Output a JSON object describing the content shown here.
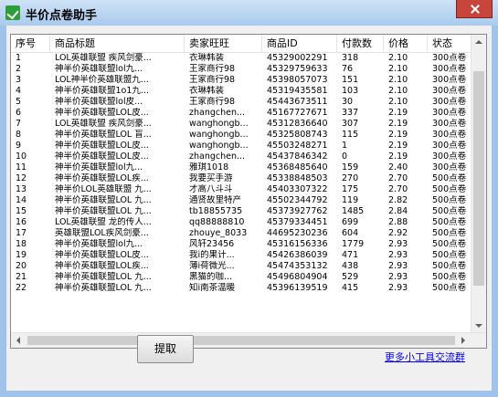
{
  "window": {
    "title": "半价点卷助手"
  },
  "table": {
    "columns": [
      "序号",
      "商品标题",
      "卖家旺旺",
      "商品ID",
      "付款数",
      "价格",
      "状态"
    ],
    "rows": [
      [
        "1",
        "LOL英雄联盟 疾风剑豪...",
        "衣琳韩装",
        "45329002291",
        "318",
        "2.10",
        "300点卷"
      ],
      [
        "2",
        "神半价英雄联盟lol九...",
        "王家商行98",
        "45329759633",
        "76",
        "2.10",
        "300点卷"
      ],
      [
        "3",
        "LOL神半价英雄联盟九...",
        "王家商行98",
        "45398057073",
        "151",
        "2.10",
        "300点卷"
      ],
      [
        "4",
        "神半价英雄联盟1o1九...",
        "衣琳韩装",
        "45319435581",
        "103",
        "2.10",
        "300点卷"
      ],
      [
        "5",
        "神半价英雄联盟lol皮...",
        "王家商行98",
        "45443673511",
        "30",
        "2.10",
        "300点卷"
      ],
      [
        "6",
        "神半价英雄联盟LOL皮...",
        "zhangchen...",
        "45167727671",
        "337",
        "2.19",
        "300点卷"
      ],
      [
        "7",
        "LOL英雄联盟 疾风剑豪...",
        "wanghongb...",
        "45312836640",
        "307",
        "2.19",
        "300点卷"
      ],
      [
        "8",
        "神半价英雄联盟LOL 盲...",
        "wanghongb...",
        "45325808743",
        "115",
        "2.19",
        "300点卷"
      ],
      [
        "9",
        "神半价英雄联盟LOL皮...",
        "wanghongb...",
        "45503248271",
        "1",
        "2.19",
        "300点卷"
      ],
      [
        "10",
        "神半价英雄联盟LOL皮...",
        "zhangchen...",
        "45437846342",
        "0",
        "2.19",
        "300点卷"
      ],
      [
        "11",
        "神半价英雄联盟lol九...",
        "雅琪1018",
        "45368485640",
        "159",
        "2.40",
        "300点卷"
      ],
      [
        "12",
        "神半价英雄联盟LOL疾...",
        "我要买手游",
        "45338848503",
        "270",
        "2.70",
        "500点卷"
      ],
      [
        "13",
        "神半价LOL英雄联盟 九...",
        "才高八斗斗",
        "45403307322",
        "175",
        "2.70",
        "500点卷"
      ],
      [
        "14",
        "神半价英雄联盟LOL 九...",
        "通贤故里特产",
        "45502344792",
        "119",
        "2.82",
        "500点卷"
      ],
      [
        "15",
        "神半价英雄联盟LOL 九...",
        "tb18855735",
        "45373927762",
        "1485",
        "2.84",
        "500点卷"
      ],
      [
        "16",
        "LOL英雄联盟 龙的传人...",
        "qq88888810",
        "45379334451",
        "699",
        "2.88",
        "500点卷"
      ],
      [
        "17",
        "英雄联盟LOL疾风剑豪...",
        "zhouye_8033",
        "44695230236",
        "604",
        "2.92",
        "500点卷"
      ],
      [
        "18",
        "神半价英雄联盟lol九...",
        "风轩23456",
        "45316156336",
        "1779",
        "2.93",
        "500点卷"
      ],
      [
        "19",
        "神半价英雄联盟LOL皮...",
        "我i的果计...",
        "45426386039",
        "471",
        "2.93",
        "500点卷"
      ],
      [
        "20",
        "神半价英雄联盟LOL疾...",
        "薄i荷微光...",
        "45474353132",
        "438",
        "2.93",
        "500点卷"
      ],
      [
        "21",
        "神半价英雄联盟LOL 九...",
        "黑猫的咖...",
        "45496804904",
        "529",
        "2.93",
        "500点卷"
      ],
      [
        "22",
        "神半价英雄联盟LOL 九...",
        "知i南茶温暖",
        "45396139519",
        "415",
        "2.93",
        "500点卷"
      ]
    ]
  },
  "buttons": {
    "extract": "提取"
  },
  "link": {
    "text": "更多小工具交流群"
  }
}
